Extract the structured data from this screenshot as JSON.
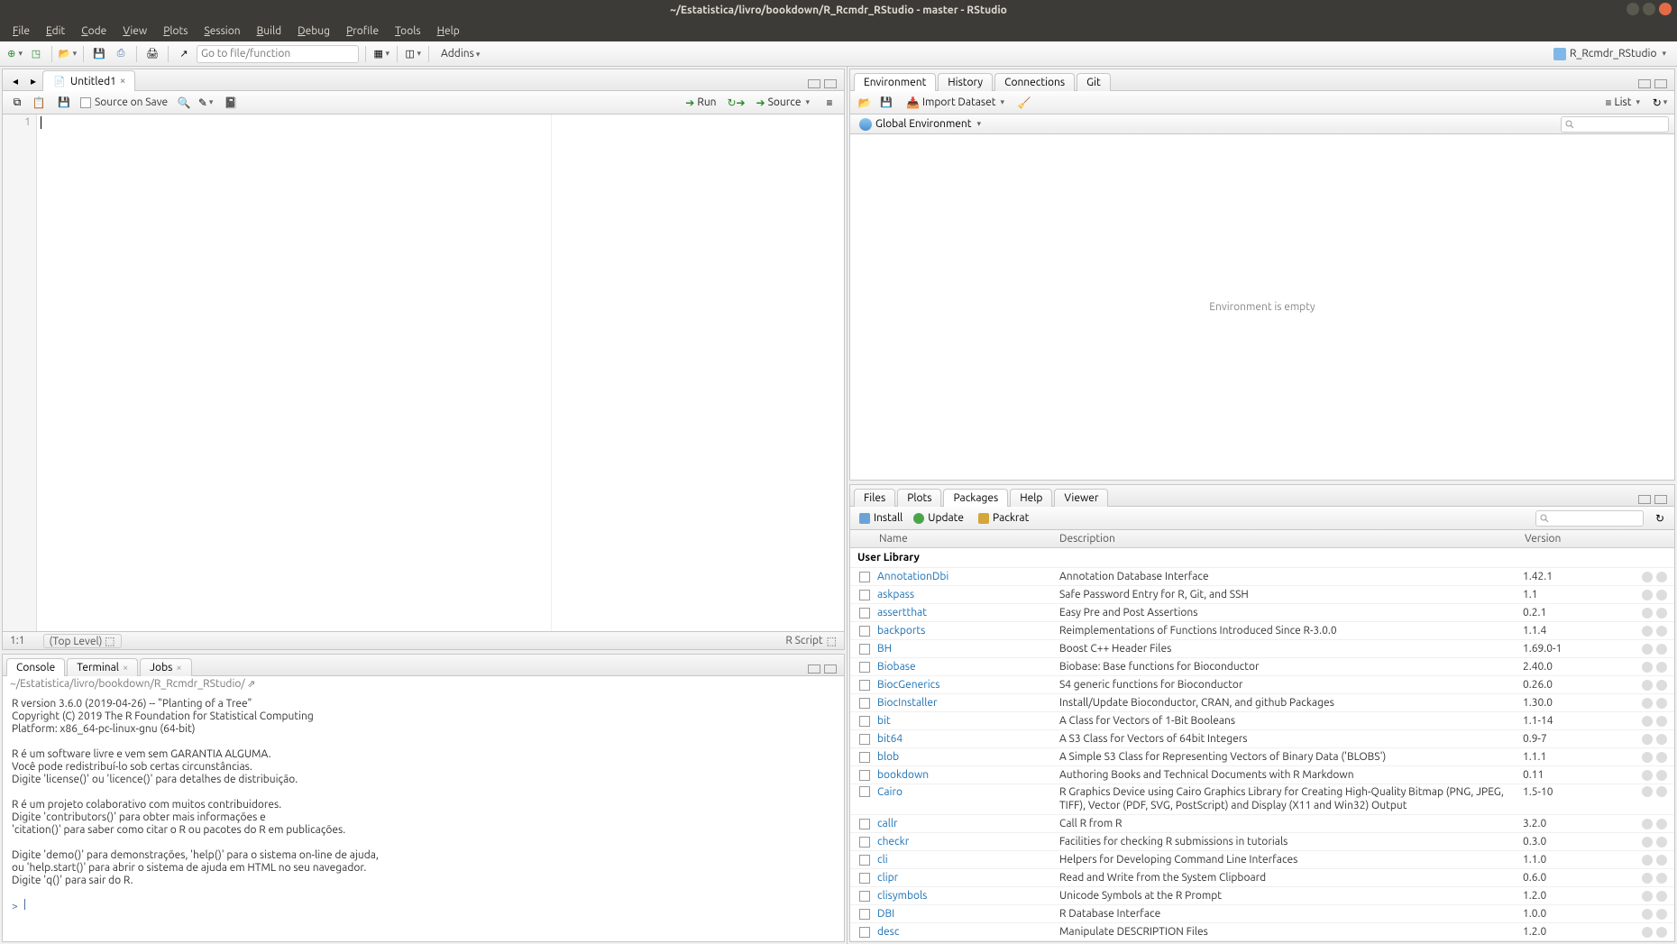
{
  "title": "~/Estatistica/livro/bookdown/R_Rcmdr_RStudio - master - RStudio",
  "menu": [
    "File",
    "Edit",
    "Code",
    "View",
    "Plots",
    "Session",
    "Build",
    "Debug",
    "Profile",
    "Tools",
    "Help"
  ],
  "goto_placeholder": "Go to file/function",
  "addins": "Addins",
  "project": "R_Rcmdr_RStudio",
  "source_tab": "Untitled1",
  "source_on_save": "Source on Save",
  "run": "Run",
  "source_btn": "Source",
  "line_col": "1:1",
  "scope": "(Top Level)",
  "script_type": "R Script",
  "gutter_line": "1",
  "console_tabs": [
    "Console",
    "Terminal",
    "Jobs"
  ],
  "console_path": "~/Estatistica/livro/bookdown/R_Rcmdr_RStudio/",
  "console_text": "R version 3.6.0 (2019-04-26) -- \"Planting of a Tree\"\nCopyright (C) 2019 The R Foundation for Statistical Computing\nPlatform: x86_64-pc-linux-gnu (64-bit)\n\nR é um software livre e vem sem GARANTIA ALGUMA.\nVocê pode redistribuí-lo sob certas circunstâncias.\nDigite 'license()' ou 'licence()' para detalhes de distribuição.\n\nR é um projeto colaborativo com muitos contribuidores.\nDigite 'contributors()' para obter mais informações e\n'citation()' para saber como citar o R ou pacotes do R em publicações.\n\nDigite 'demo()' para demonstrações, 'help()' para o sistema on-line de ajuda,\nou 'help.start()' para abrir o sistema de ajuda em HTML no seu navegador.\nDigite 'q()' para sair do R.\n",
  "prompt": ">",
  "env_tabs": [
    "Environment",
    "History",
    "Connections",
    "Git"
  ],
  "import": "Import Dataset",
  "list": "List",
  "global_env": "Global Environment",
  "env_empty": "Environment is empty",
  "pkg_tabs": [
    "Files",
    "Plots",
    "Packages",
    "Help",
    "Viewer"
  ],
  "install": "Install",
  "update": "Update",
  "packrat": "Packrat",
  "hdr_name": "Name",
  "hdr_desc": "Description",
  "hdr_ver": "Version",
  "user_lib": "User Library",
  "packages": [
    {
      "n": "AnnotationDbi",
      "d": "Annotation Database Interface",
      "v": "1.42.1"
    },
    {
      "n": "askpass",
      "d": "Safe Password Entry for R, Git, and SSH",
      "v": "1.1"
    },
    {
      "n": "assertthat",
      "d": "Easy Pre and Post Assertions",
      "v": "0.2.1"
    },
    {
      "n": "backports",
      "d": "Reimplementations of Functions Introduced Since R-3.0.0",
      "v": "1.1.4"
    },
    {
      "n": "BH",
      "d": "Boost C++ Header Files",
      "v": "1.69.0-1"
    },
    {
      "n": "Biobase",
      "d": "Biobase: Base functions for Bioconductor",
      "v": "2.40.0"
    },
    {
      "n": "BiocGenerics",
      "d": "S4 generic functions for Bioconductor",
      "v": "0.26.0"
    },
    {
      "n": "BiocInstaller",
      "d": "Install/Update Bioconductor, CRAN, and github Packages",
      "v": "1.30.0"
    },
    {
      "n": "bit",
      "d": "A Class for Vectors of 1-Bit Booleans",
      "v": "1.1-14"
    },
    {
      "n": "bit64",
      "d": "A S3 Class for Vectors of 64bit Integers",
      "v": "0.9-7"
    },
    {
      "n": "blob",
      "d": "A Simple S3 Class for Representing Vectors of Binary Data ('BLOBS')",
      "v": "1.1.1"
    },
    {
      "n": "bookdown",
      "d": "Authoring Books and Technical Documents with R Markdown",
      "v": "0.11"
    },
    {
      "n": "Cairo",
      "d": "R Graphics Device using Cairo Graphics Library for Creating High-Quality Bitmap (PNG, JPEG, TIFF), Vector (PDF, SVG, PostScript) and Display (X11 and Win32) Output",
      "v": "1.5-10",
      "multi": true
    },
    {
      "n": "callr",
      "d": "Call R from R",
      "v": "3.2.0"
    },
    {
      "n": "checkr",
      "d": "Facilities for checking R submissions in tutorials",
      "v": "0.3.0"
    },
    {
      "n": "cli",
      "d": "Helpers for Developing Command Line Interfaces",
      "v": "1.1.0"
    },
    {
      "n": "clipr",
      "d": "Read and Write from the System Clipboard",
      "v": "0.6.0"
    },
    {
      "n": "clisymbols",
      "d": "Unicode Symbols at the R Prompt",
      "v": "1.2.0"
    },
    {
      "n": "DBI",
      "d": "R Database Interface",
      "v": "1.0.0"
    },
    {
      "n": "desc",
      "d": "Manipulate DESCRIPTION Files",
      "v": "1.2.0"
    }
  ]
}
